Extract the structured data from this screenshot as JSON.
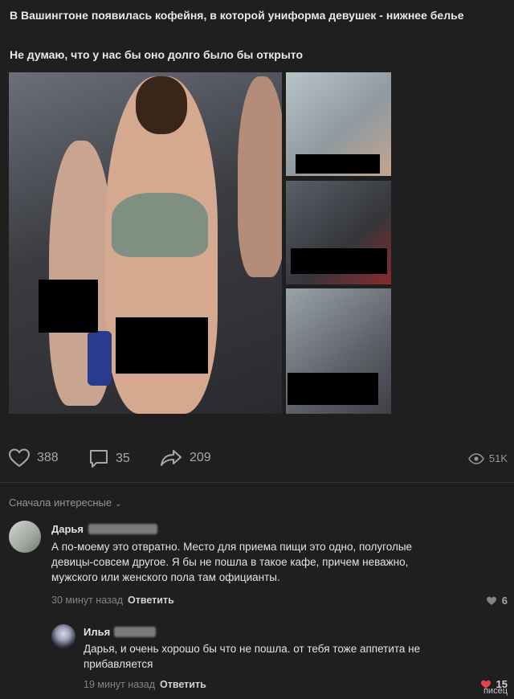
{
  "post": {
    "title_line": "В Вашингтоне появилась кофейня, в которой униформа девушек - нижнее белье",
    "comment_line": "Не думаю, что у нас бы оно долго было бы открыто"
  },
  "actions": {
    "likes": "388",
    "comments": "35",
    "shares": "209",
    "views": "51K"
  },
  "comments_sort": {
    "label": "Сначала интересные"
  },
  "comments": [
    {
      "author": "Дарья",
      "text_lines": [
        "А по-моему это отвратно. Место для приема пищи это одно, полуголые",
        "девицы-совсем другое. Я бы не пошла в такое кафе, причем неважно,",
        "мужского или женского пола там официанты."
      ],
      "time": "30 минут назад",
      "reply_label": "Ответить",
      "likes": "6"
    },
    {
      "author": "Илья",
      "text_lines": [
        "Дарья, и очень хорошо бы что не пошла. от тебя тоже аппетита не",
        "прибавляется"
      ],
      "time": "19 минут назад",
      "reply_label": "Ответить",
      "likes": "15"
    }
  ],
  "watermark": "писец",
  "colors": {
    "background": "#1f1f20",
    "text": "#e1e3e6",
    "secondary": "#939599",
    "like_red": "#e64646"
  }
}
